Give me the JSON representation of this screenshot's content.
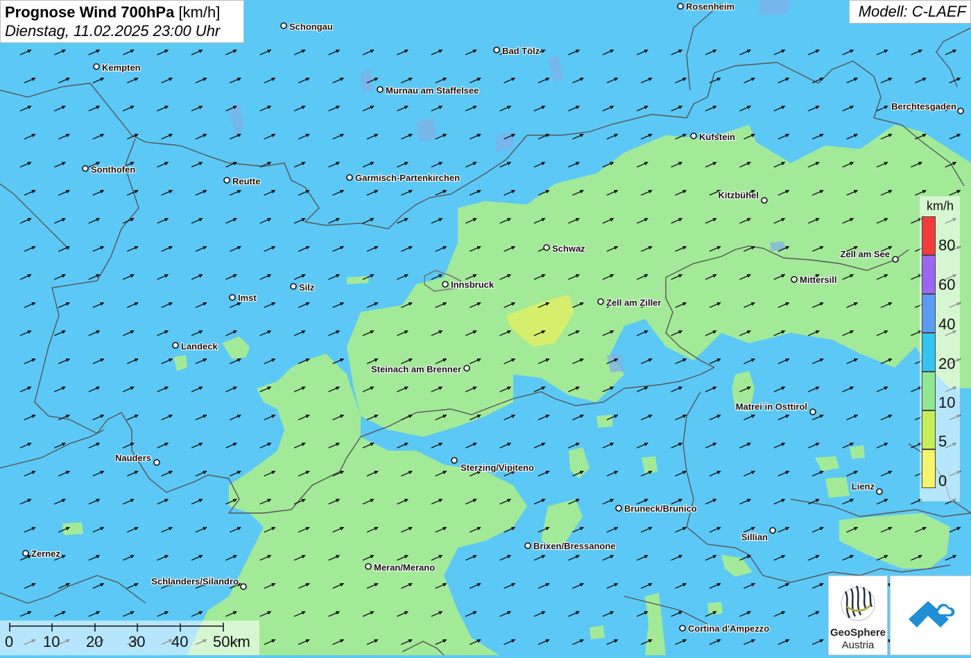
{
  "title": {
    "main": "Prognose Wind 700hPa",
    "unit": "[km/h]",
    "datetime": "Dienstag, 11.02.2025 23:00 Uhr"
  },
  "model": "Modell: C-LAEF",
  "legend": {
    "unit": "km/h",
    "classes": [
      {
        "label": "80",
        "color": "#f23b3b"
      },
      {
        "label": "60",
        "color": "#9c66f0"
      },
      {
        "label": "40",
        "color": "#5d9af3"
      },
      {
        "label": "20",
        "color": "#35c4f2"
      },
      {
        "label": "10",
        "color": "#8fe890"
      },
      {
        "label": "5",
        "color": "#c6ee55"
      },
      {
        "label": "0",
        "color": "#f6f56a"
      }
    ]
  },
  "scale_bar": {
    "labels": [
      "0",
      "10",
      "20",
      "30",
      "40",
      "50km"
    ]
  },
  "cities": [
    {
      "name": "Rosenheim"
    },
    {
      "name": "Schongau"
    },
    {
      "name": "Bad Tölz"
    },
    {
      "name": "Kempten"
    },
    {
      "name": "Murnau am Staffelsee"
    },
    {
      "name": "Berchtesgaden"
    },
    {
      "name": "Kufstein"
    },
    {
      "name": "Sonthofen"
    },
    {
      "name": "Reutte"
    },
    {
      "name": "Garmisch-Partenkirchen"
    },
    {
      "name": "Kitzbühel"
    },
    {
      "name": "Schwaz"
    },
    {
      "name": "Zell am See"
    },
    {
      "name": "Mittersill"
    },
    {
      "name": "Silz"
    },
    {
      "name": "Innsbruck"
    },
    {
      "name": "Imst"
    },
    {
      "name": "Zell am Ziller"
    },
    {
      "name": "Landeck"
    },
    {
      "name": "Steinach am Brenner"
    },
    {
      "name": "Matrei in Osttirol"
    },
    {
      "name": "Nauders"
    },
    {
      "name": "Sterzing/Vipiteno"
    },
    {
      "name": "Lienz"
    },
    {
      "name": "Bruneck/Brunico"
    },
    {
      "name": "Sillian"
    },
    {
      "name": "Brixen/Bressanone"
    },
    {
      "name": "Zernez"
    },
    {
      "name": "Meran/Merano"
    },
    {
      "name": "Schlanders/Silandro"
    },
    {
      "name": "Cortina d'Ampezzo"
    }
  ],
  "logo": {
    "org_name": "GeoSphere",
    "org_country": "Austria"
  },
  "colors": {
    "wind_10_20": "#5bc8f5",
    "wind_5_10": "#a3ea98",
    "wind_0_5": "#d5ef6c",
    "arrow": "#111111",
    "border": "#555555"
  }
}
